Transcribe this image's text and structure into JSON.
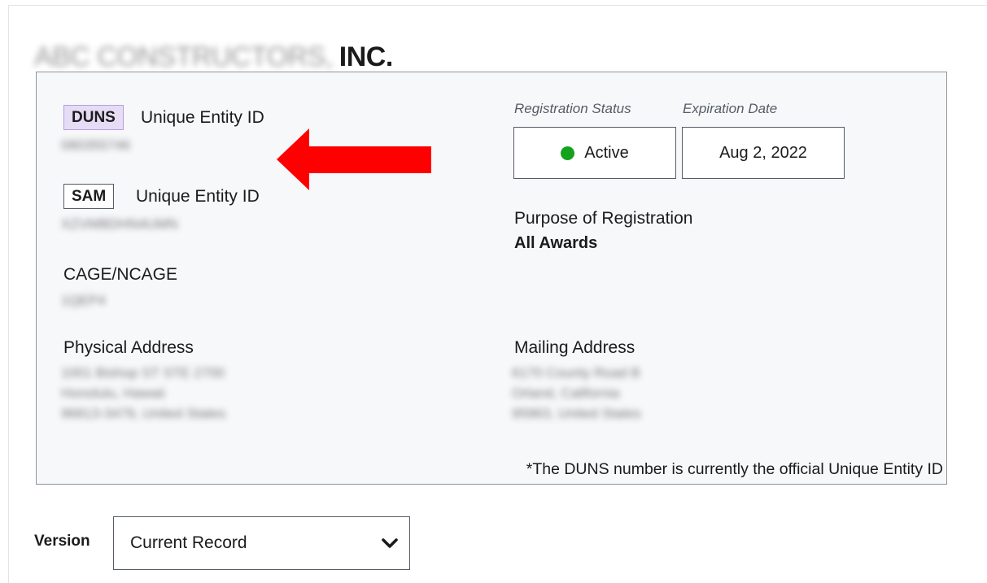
{
  "entity": {
    "name_redacted": "ABC CONSTRUCTORS,",
    "name_suffix": "INC."
  },
  "identifiers": {
    "duns_tag": "DUNS",
    "duns_label": "Unique Entity ID",
    "duns_value_redacted": "080355746",
    "sam_tag": "SAM",
    "sam_label": "Unique Entity ID",
    "sam_value_redacted": "XZVMBDHN4UMN",
    "cage_label": "CAGE/NCAGE",
    "cage_value_redacted": "1QEP4"
  },
  "registration": {
    "status_heading": "Registration Status",
    "expiration_heading": "Expiration Date",
    "status_value": "Active",
    "status_color": "#14a21d",
    "expiration_value": "Aug 2, 2022",
    "purpose_label": "Purpose of Registration",
    "purpose_value": "All Awards"
  },
  "addresses": {
    "physical_label": "Physical Address",
    "physical_lines_redacted": [
      "1001 Bishop ST STE 2700",
      "Honolulu, Hawaii",
      "96813-3479, United States"
    ],
    "mailing_label": "Mailing Address",
    "mailing_lines_redacted": [
      "6170 County Road B",
      "Orland, California",
      "95963, United States"
    ]
  },
  "footnote": "*The DUNS number is currently the official Unique Entity ID",
  "version": {
    "label": "Version",
    "selected": "Current Record"
  },
  "colors": {
    "panel_bg": "#f7f8fa",
    "panel_border": "#8e959c",
    "duns_tag_bg": "#e6dcf6",
    "arrow": "#ff0000"
  }
}
